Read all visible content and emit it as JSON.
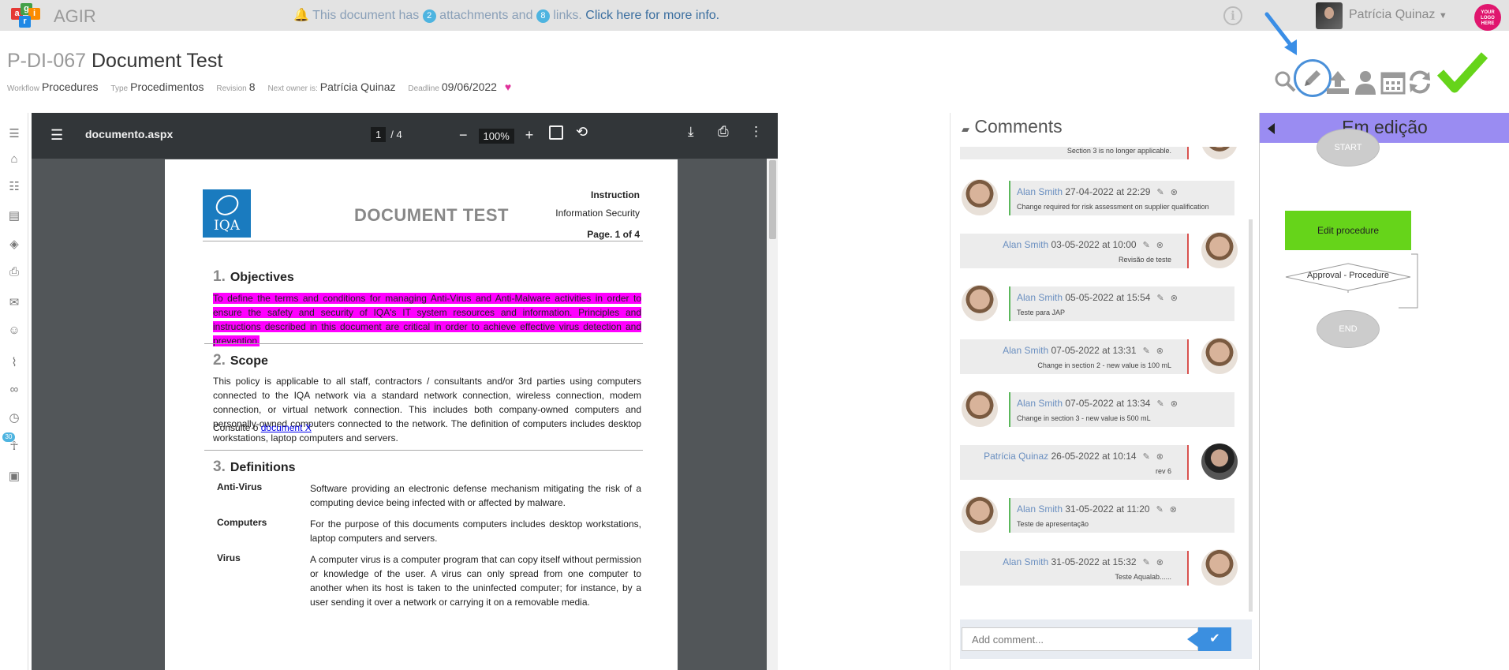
{
  "topbar": {
    "logo_letters": [
      "a",
      "g",
      "i",
      "r"
    ],
    "app_name": "AGIR",
    "notice_pre": "This document has",
    "attachments_count": "2",
    "notice_mid": "attachments and",
    "links_count": "8",
    "notice_post": "links.",
    "notice_link": "Click here for more info.",
    "user_name": "Patrícia Quinaz",
    "company_logo_text": "YOUR LOGO HERE"
  },
  "header": {
    "doc_code": "P-DI-067",
    "doc_title": "Document Test",
    "workflow_label": "Workflow",
    "workflow_value": "Procedures",
    "type_label": "Type",
    "type_value": "Procedimentos",
    "revision_label": "Revision",
    "revision_value": "8",
    "owner_label": "Next owner is:",
    "owner_value": "Patrícia Quinaz",
    "deadline_label": "Deadline",
    "deadline_value": "09/06/2022"
  },
  "viewer": {
    "filename": "documento.aspx",
    "current_page": "1",
    "total_pages": "/ 4",
    "zoom": "100%"
  },
  "document": {
    "heading": "DOCUMENT TEST",
    "logo_text": "IQA",
    "instruction": "Instruction",
    "category": "Information Security",
    "page_info": "Page. 1 of 4",
    "sec1_num": "1.",
    "sec1_title": "Objectives",
    "sec1_text": "To define the terms and conditions for managing Anti-Virus and Anti-Malware activities in order to ensure the safety and security of IQA's IT system resources and information. Principles and instructions described in this document are critical in order to achieve effective virus detection and prevention.",
    "sec2_num": "2.",
    "sec2_title": "Scope",
    "sec2_text": "This policy is applicable to all staff, contractors / consultants and/or 3rd parties using computers connected to the IQA network via a standard network connection, wireless connection, modem connection, or virtual network connection. This includes both company-owned computers and personally-owned computers connected to the network. The definition of computers includes desktop workstations, laptop computers and servers.",
    "sec2_consult": "Consulte o",
    "sec2_link": "document X",
    "sec3_num": "3.",
    "sec3_title": "Definitions",
    "definitions": [
      {
        "term": "Anti-Virus",
        "desc": "Software providing an electronic defense mechanism mitigating the risk of a computing device being infected with or affected by malware."
      },
      {
        "term": "Computers",
        "desc": "For the purpose of this documents computers includes desktop workstations, laptop computers and servers."
      },
      {
        "term": "Virus",
        "desc": "A computer virus is a computer program that can copy itself without permission or knowledge of the user. A virus can only spread from one computer to another when its host is taken to the uninfected computer; for instance, by a user sending it over a network or carrying it on a removable media."
      }
    ]
  },
  "comments": {
    "title": "Comments",
    "items": [
      {
        "side": "right",
        "author": "",
        "date": "",
        "text": "Section 3 is no longer applicable."
      },
      {
        "side": "left",
        "author": "Alan Smith",
        "date": "27-04-2022 at 22:29",
        "text": "Change required for risk assessment on supplier qualification"
      },
      {
        "side": "right",
        "author": "Alan Smith",
        "date": "03-05-2022 at 10:00",
        "text": "Revisão de teste"
      },
      {
        "side": "left",
        "author": "Alan Smith",
        "date": "05-05-2022 at 15:54",
        "text": "Teste para JAP"
      },
      {
        "side": "right",
        "author": "Alan Smith",
        "date": "07-05-2022 at 13:31",
        "text": "Change in section 2 - new value is 100 mL"
      },
      {
        "side": "left",
        "author": "Alan Smith",
        "date": "07-05-2022 at 13:34",
        "text": "Change in section 3 - new value is 500 mL"
      },
      {
        "side": "right",
        "author": "Patrícia Quinaz",
        "date": "26-05-2022 at 10:14",
        "text": "rev 6"
      },
      {
        "side": "left",
        "author": "Alan Smith",
        "date": "31-05-2022 at 11:20",
        "text": "Teste de apresentação"
      },
      {
        "side": "right",
        "author": "Alan Smith",
        "date": "31-05-2022 at 15:32",
        "text": "Teste Aqualab......"
      }
    ],
    "add_placeholder": "Add comment..."
  },
  "workflow": {
    "status": "Em edição",
    "start": "START",
    "edit": "Edit procedure",
    "approval": "Approval - Procedure",
    "end": "END"
  },
  "colors": {
    "accent_blue": "#4a90d9",
    "highlight": "#ff00ff",
    "approve_green": "#66d41a",
    "status_purple": "#9a8cf2"
  }
}
